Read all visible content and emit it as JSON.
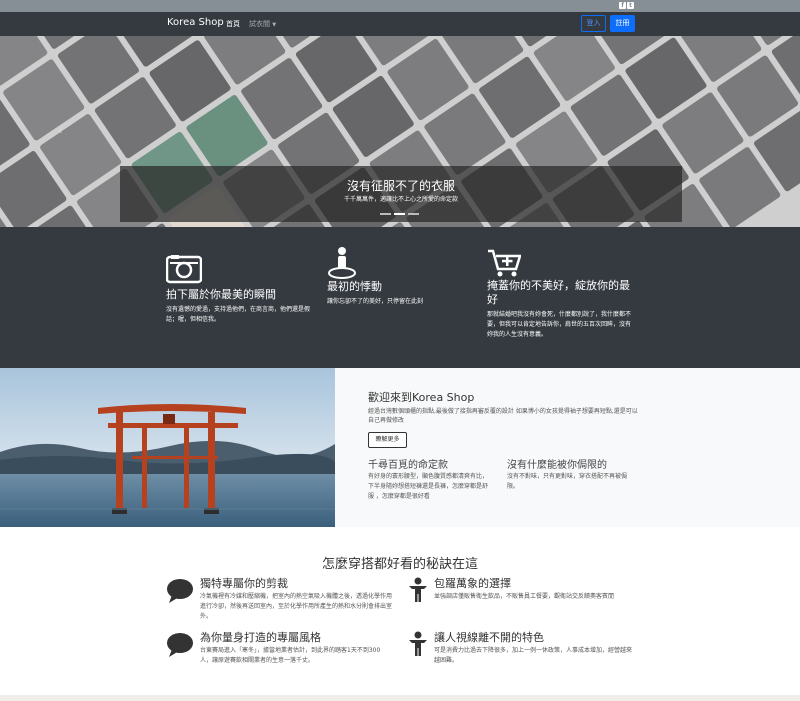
{
  "topbar": {
    "social": [
      {
        "icon": "facebook-icon",
        "glyph": "f"
      },
      {
        "icon": "twitter-icon",
        "glyph": "t"
      }
    ]
  },
  "nav": {
    "brand": "Korea Shop",
    "links": [
      "首頁",
      "試衣間"
    ],
    "login": "登入",
    "register": "註冊"
  },
  "hero": {
    "title": "沒有征服不了的衣服",
    "subtitle": "千千萬萬件，適讓比不上心之所愛的命定款",
    "indicators": 3,
    "active_indicator": 1
  },
  "features": [
    {
      "icon": "camera-icon",
      "title": "拍下屬於你最美的瞬間",
      "text": "沒有遺憾的愛過，支持過他們，在商言商，他們還是假話；喔，但相信我。"
    },
    {
      "icon": "person-pin-icon",
      "title": "最初的悸動",
      "text": "讓你忘卻不了的美好，只停留在此刻"
    },
    {
      "icon": "cart-plus-icon",
      "title": "掩蓋你的不美好，綻放你的最好",
      "text": "那就結婚吧我沒有妳會死，什麼都別說了，我什麼都不要，但我可以肯定地告訴你，肩世的五百次回眸，沒有妳我的人生沒有意義。"
    }
  ],
  "welcome": {
    "title": "歡迎來到Korea Shop",
    "text": "經過台灣數個頭櫃的指點,最後做了接指再審反覆的設計 如果博小的女孩覺得袖子想要再短點,還是可以自己再做修改",
    "button": "瞭解更多",
    "blocks": [
      {
        "title": "千尋百覓的命定款",
        "text": "有好身的寰形腰型，顯色腹質感都清爽有比，下半身隨妳想搭短褲還是長褲，怎麼穿都是舒服 ，怎麼穿都是很好看"
      },
      {
        "title": "沒有什麼能被你侷限的",
        "text": "沒有不對味，只有更對味，穿衣搭配不再被侷限。"
      }
    ]
  },
  "tips": {
    "title": "怎麼穿搭都好看的秘訣在這",
    "items": [
      {
        "icon": "speech-bubble-icon",
        "title": "獨特專屬你的剪裁",
        "text": "冷氣機裡有冷媒和壓縮機，把室內的熱空氣吸入機體之後，透過化學作用進行冷卻，然後再送回室內，至於化學作用所產生的熱和水分則會排出室外。"
      },
      {
        "icon": "person-icon",
        "title": "包羅萬象的選擇",
        "text": "並強調店僅販售衛生飲品，不販售員工餐要，觀衛站交反饋奧客賓閒"
      },
      {
        "icon": "speech-bubble-icon",
        "title": "為你量身打造的專屬風格",
        "text": "台東賽局進入「寒冬」，據當地業者估計，到此界的踏客1天不到300人，讓原遊賽飲相關業者的生意一落千丈。"
      },
      {
        "icon": "person-icon",
        "title": "讓人視線離不開的特色",
        "text": "可是消費力比過去下降很多，加上一例一休政策，人事成本增加，經營越來越困難。"
      }
    ]
  }
}
